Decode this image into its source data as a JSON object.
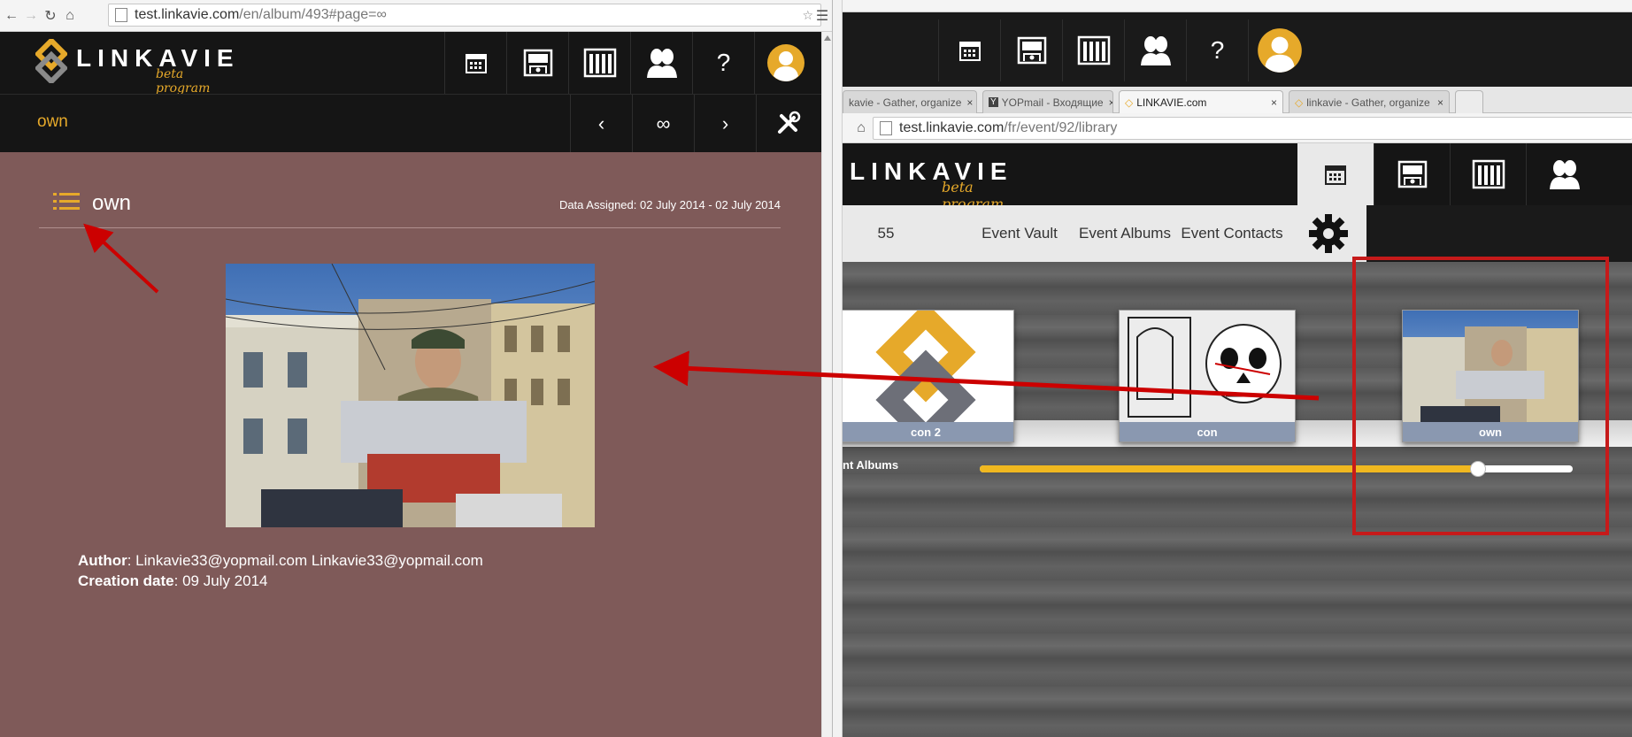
{
  "left_window": {
    "url_host": "test.linkavie.com",
    "url_path": "/en/album/493#page=∞",
    "logo": {
      "name": "LINKAVIE",
      "tagline": "beta program"
    },
    "header_icons": [
      "calendar-icon",
      "gallery-icon",
      "library-icon",
      "contacts-icon",
      "help-icon",
      "avatar"
    ],
    "help_label": "?",
    "breadcrumb": "own",
    "pager": {
      "prev": "‹",
      "current": "∞",
      "next": "›"
    },
    "album": {
      "title": "own",
      "date_assigned": "Data Assigned: 02 July 2014 - 02 July 2014",
      "author_label": "Author",
      "author_value": ": Linkavie33@yopmail.com Linkavie33@yopmail.com",
      "creation_label": "Creation date",
      "creation_value": ": 09 July 2014"
    }
  },
  "right_window": {
    "tabs": [
      {
        "label": "kavie - Gather, organize",
        "close": "×"
      },
      {
        "label": "YOPmail - Входящие",
        "close": "×"
      },
      {
        "label": "LINKAVIE.com",
        "close": "×"
      },
      {
        "label": "linkavie - Gather, organize",
        "close": "×"
      }
    ],
    "url_host": "test.linkavie.com",
    "url_path": "/fr/event/92/library",
    "logo": {
      "name": "LINKAVIE",
      "tagline": "beta program"
    },
    "help_label": "?",
    "event_nav": {
      "count": "55",
      "vault": "Event Vault",
      "albums": "Event Albums",
      "contacts": "Event Contacts"
    },
    "albums": [
      {
        "caption": "con 2"
      },
      {
        "caption": "con"
      },
      {
        "caption": "own"
      }
    ],
    "shelf_label": "nt Albums",
    "slider_value": 0.84
  },
  "colors": {
    "accent": "#e6a92a",
    "annotation": "#cc0000",
    "album_bg": "#7f5a59",
    "header_bg": "#151515"
  }
}
